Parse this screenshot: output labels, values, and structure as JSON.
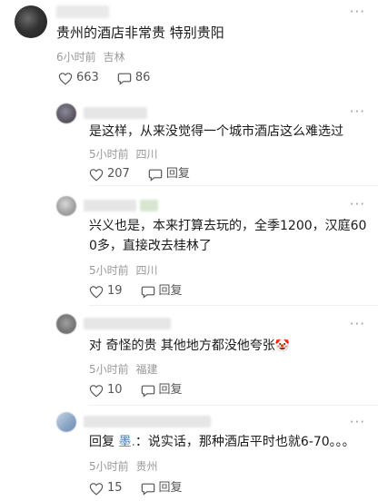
{
  "top_comment": {
    "text": "贵州的酒店非常贵 特别贵阳",
    "time": "6小时前",
    "location": "吉林",
    "likes": "663",
    "comments": "86"
  },
  "more_icon": "···",
  "replies": [
    {
      "text": "是这样，从来没觉得一个城市酒店这么难选过",
      "time": "5小时前",
      "location": "四川",
      "likes": "207",
      "reply_label": "回复"
    },
    {
      "text": "兴义也是，本来打算去玩的，全季1200，汉庭600多，直接改去桂林了",
      "time": "5小时前",
      "location": "四川",
      "likes": "19",
      "reply_label": "回复"
    },
    {
      "text": "对 奇怪的贵 其他地方都没他夸张",
      "emoji": "🤡",
      "time": "5小时前",
      "location": "福建",
      "likes": "10",
      "reply_label": "回复"
    },
    {
      "reply_prefix": "回复",
      "reply_to": "墨.",
      "text": "：说实话，那种酒店平时也就6-70。。。",
      "time": "5小时前",
      "location": "贵州",
      "likes": "15",
      "reply_label": "回复"
    }
  ],
  "colors": {
    "meta": "#999999",
    "link": "#4a78b5",
    "text": "#1a1a1a"
  }
}
